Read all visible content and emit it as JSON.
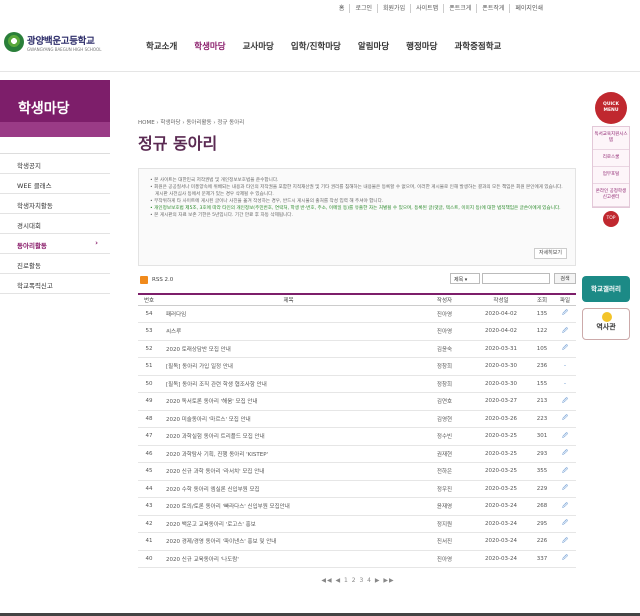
{
  "util_links": [
    "홈",
    "로그인",
    "회원가입",
    "사이트맵",
    "폰트크게",
    "폰트작게",
    "페이지인쇄"
  ],
  "logo": {
    "name": "광양백운고등학교",
    "sub": "GWANGYANG BAEGUN HIGH SCHOOL"
  },
  "gnb": [
    "학교소개",
    "학생마당",
    "교사마당",
    "입학/진학마당",
    "알림마당",
    "행정마당",
    "과학중점학교"
  ],
  "lnb": {
    "title": "학생마당",
    "items": [
      "학생공지",
      "WEE 클래스",
      "학생자치활동",
      "경시대회",
      "동아리활동",
      "진로활동",
      "학교폭력신고"
    ]
  },
  "breadcrumb": "HOME › 학생마당 › 동아리활동 › 정규 동아리",
  "page_title": "정규 동아리",
  "notice": {
    "lines": [
      "• 본 사이트는 대한민국 저작권법 및 개인정보보호법을 준수합니다.",
      "• 회원은 공공질서나 미풍양속에 위배되는 내용과 타인의 저작권을 포함한 지적재산권 및 기타 권리를 침해하는 내용물은 등록할 수 없으며, 이러한 게시물로 인해 발생하는 결과의 모든 책임은 회원 본인에게 있습니다. 게시판 사전심사 등에서 문제가 있는 경우 삭제될 수 있습니다.",
      "• 무작위하게 타 사이트에 게시된 글이나 사진을 옮겨 작성하는 경우, 반드시 게시물의 출처를 작성 입력 해 주셔야 합니다.",
      "• 개인정보보호법 제5조, 3호에 따라 타인의 개인정보(주민번호, 연락처, 학생 반·번호, 주소, 이메일 등)를 유출한 자는 처벌될 수 있으며, 등록된 글(댓글, 텍스트, 이미지 등)에 대한 법적책임은 글쓴이에게 있습니다.",
      "• 본 게시판의 자료 보존 기한은 5년입니다. 기간 만료 후 자동 삭제됩니다."
    ],
    "more": "자세히보기"
  },
  "rss_label": "RSS 2.0",
  "search": {
    "select": "제목 ▾",
    "button": "검색"
  },
  "table": {
    "headers": [
      "번호",
      "제목",
      "작성자",
      "작성일",
      "조회",
      "파일"
    ],
    "rows": [
      [
        "54",
        "패러다임",
        "진아영",
        "2020-04-02",
        "135",
        "🖉"
      ],
      [
        "53",
        "씨스루",
        "진아영",
        "2020-04-02",
        "122",
        "🖉"
      ],
      [
        "52",
        "2020 토래상담반 모집 안내",
        "김윤숙",
        "2020-03-31",
        "105",
        "🖉"
      ],
      [
        "51",
        "[필독] 동아리 가입 일정 안내",
        "정창희",
        "2020-03-30",
        "236",
        "-"
      ],
      [
        "50",
        "[필독] 동아리 조직 관련 학생 협조사항 안내",
        "정창희",
        "2020-03-30",
        "155",
        "-"
      ],
      [
        "49",
        "2020 독서토론 동아리 '해움' 모집 안내",
        "김연호",
        "2020-03-27",
        "213",
        "🖉"
      ],
      [
        "48",
        "2020 미술동아리 '마르스' 모집 안내",
        "김영현",
        "2020-03-26",
        "223",
        "🖉"
      ],
      [
        "47",
        "2020 과학실험 동아리 트리플드 모집 안내",
        "정수빈",
        "2020-03-25",
        "301",
        "🖉"
      ],
      [
        "46",
        "2020 과학탐사 기획, 진행 동아리 'KISTEP'",
        "권재현",
        "2020-03-25",
        "293",
        "🖉"
      ],
      [
        "45",
        "2020 신규 과학 동아리 '라서치' 모집 안내",
        "전하은",
        "2020-03-25",
        "355",
        "🖉"
      ],
      [
        "44",
        "2020 수학 동아리 엠실론 신입부원 모집",
        "정우진",
        "2020-03-25",
        "229",
        "🖉"
      ],
      [
        "43",
        "2020 토의/토론 동아리 '빠라다스' 신입부원 모집안내",
        "윤재영",
        "2020-03-24",
        "268",
        "🖉"
      ],
      [
        "42",
        "2020 백운고 교육동아리 '로고스' 홍보",
        "정지원",
        "2020-03-24",
        "295",
        "🖉"
      ],
      [
        "41",
        "2020 경제/경영 동아리 '파이낸스' 홍보 및 안내",
        "진서진",
        "2020-03-24",
        "226",
        "🖉"
      ],
      [
        "40",
        "2020 신규 교육동아리 '나도람'",
        "진아영",
        "2020-03-24",
        "337",
        "🖉"
      ]
    ]
  },
  "pager": "◀◀ ◀ 1 2 3 4 ▶ ▶▶",
  "quick": {
    "badge": "QUICK MENU",
    "items": [
      "독서교육지원시스템",
      "리로스쿨",
      "업무포털",
      "온라인 공정학생 신고센터"
    ],
    "top": "TOP"
  },
  "banners": {
    "gallery": "학교갤러리",
    "history": "역사관"
  }
}
